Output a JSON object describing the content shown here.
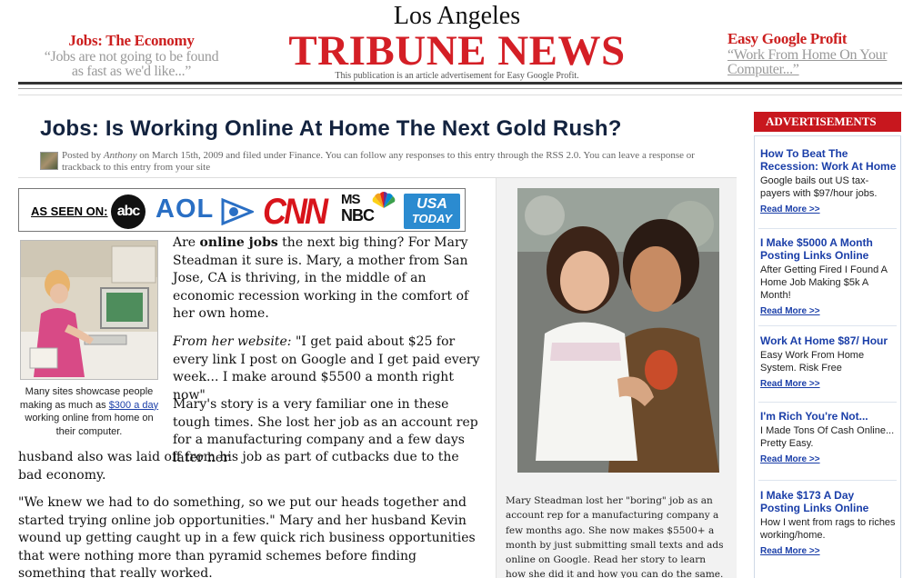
{
  "masthead": {
    "left_kicker": "Jobs: The Economy",
    "left_quote": "“Jobs are not going to be found as fast as we'd like...”",
    "city": "Los Angeles",
    "brand": "TRIBUNE NEWS",
    "disclaimer": "This publication is an article advertisement for Easy Google Profit.",
    "right_kicker": "Easy Google Profit",
    "right_quote": "“Work From Home On Your Computer...”",
    "colors": {
      "brand_red": "#d41f26",
      "kicker_red": "#cc1f1f",
      "quote_gray": "#9a9a9a"
    }
  },
  "article": {
    "headline": "Jobs: Is Working Online At Home The Next Gold Rush?",
    "byline_prefix": "Posted by",
    "byline_author": "Anthony",
    "byline_rest": "on March 15th, 2009 and filed under Finance. You can follow any responses to this entry through the RSS 2.0. You can leave a response or trackback to this entry from your site",
    "as_seen_on": {
      "label": "AS SEEN ON:",
      "logos": {
        "abc": "abc",
        "aol": "AOL",
        "cnn": "CNN",
        "msnbc_top": "MS",
        "msnbc_bottom": "NBC",
        "usatoday_top": "USA",
        "usatoday_bottom": "TODAY"
      }
    },
    "photo_left_caption_before": "Many sites showcase people making as much as ",
    "photo_left_caption_link": "$300 a day",
    "photo_left_caption_after": " working online from home on their computer.",
    "p1_before": "Are ",
    "p1_bold": "online jobs",
    "p1_after": " the next big thing? For Mary Steadman it sure is. Mary, a mother from San Jose, CA is thriving, in the middle of an economic recession working in the comfort of her own home.",
    "p2_italic": "From her website:",
    "p2_rest": " \"I get paid about $25 for every link I post on Google and I get paid every week... I make around $5500 a month right now\"",
    "p3_line_a": "Mary's story is a very familiar one in these tough times. She lost her job as an account rep for a manufacturing company and a few days later her",
    "p3_line_b": "husband also was laid off from his job as part of cutbacks due to the bad economy.",
    "p4": "\"We knew we had to do something, so we put our heads together and started trying online job opportunities.\" Mary and her husband Kevin wound up getting caught up in a few quick rich business opportunities that were nothing more than pyramid schemes before finding something that really worked."
  },
  "photo_mid_caption": "Mary Steadman lost her \"boring\" job as an account rep for a manufacturing company a few months ago. She now makes $5500+ a month by just submitting small texts and ads online on Google. Read her story to learn how she did it and how you can do the same.",
  "sidebar": {
    "header": "ADVERTISEMENTS",
    "ads": [
      {
        "title": "How To Beat The Recession: Work At Home",
        "desc": "Google bails out US tax-payers with $97/hour jobs.",
        "more": "Read More >>"
      },
      {
        "title": "I Make $5000 A Month Posting Links Online",
        "desc": "After Getting Fired I Found A Home Job Making $5k A Month!",
        "more": "Read More >>"
      },
      {
        "title": "Work At Home $87/ Hour",
        "desc": "Easy Work From Home System. Risk Free",
        "more": "Read More >>"
      },
      {
        "title": "I'm Rich You're Not...",
        "desc": "I Made Tons Of Cash Online... Pretty Easy.",
        "more": "Read More >>"
      },
      {
        "title": "I Make $173 A Day Posting Links Online",
        "desc": "How I went from rags to riches working/home.",
        "more": "Read More >>"
      }
    ]
  }
}
